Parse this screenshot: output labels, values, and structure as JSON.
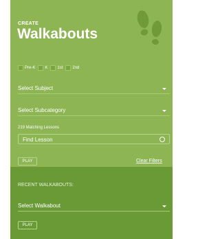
{
  "header": {
    "eyebrow": "CREATE",
    "title": "Walkabouts",
    "icon": "footprints-icon"
  },
  "grades": [
    {
      "label": "Pre-K",
      "checked": false
    },
    {
      "label": "K",
      "checked": false
    },
    {
      "label": "1st",
      "checked": false
    },
    {
      "label": "2nd",
      "checked": false
    }
  ],
  "filters": {
    "subject": "Select Subject",
    "subcategory": "Select Subcategory",
    "count_text": "219 Matching Lessons",
    "find_placeholder": "Find Lesson"
  },
  "actions": {
    "play_label": "PLAY",
    "clear_label": "Clear Filters"
  },
  "recent": {
    "heading": "RECENT WALKABOUTS:",
    "select_label": "Select Walkabout",
    "play_label": "PLAY"
  },
  "colors": {
    "panel_top": "#8db553",
    "panel_bottom": "#6a9a36",
    "footprint": "#6f9a37"
  }
}
